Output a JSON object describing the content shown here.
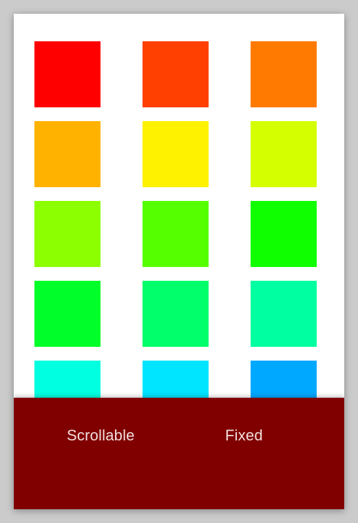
{
  "swatches": [
    {
      "name": "red",
      "color": "#ff0000"
    },
    {
      "name": "red-orange",
      "color": "#ff4000"
    },
    {
      "name": "orange",
      "color": "#ff7a00"
    },
    {
      "name": "amber",
      "color": "#ffb300"
    },
    {
      "name": "yellow",
      "color": "#fff200"
    },
    {
      "name": "yellow-green",
      "color": "#d4ff00"
    },
    {
      "name": "chartreuse",
      "color": "#8cff00"
    },
    {
      "name": "lime",
      "color": "#55ff00"
    },
    {
      "name": "green",
      "color": "#10ff00"
    },
    {
      "name": "bright-green",
      "color": "#00ff2a"
    },
    {
      "name": "spring-green",
      "color": "#00ff6a"
    },
    {
      "name": "aquamarine",
      "color": "#00ffa0"
    },
    {
      "name": "turquoise",
      "color": "#00ffe0"
    },
    {
      "name": "cyan",
      "color": "#00e5ff"
    },
    {
      "name": "azure",
      "color": "#00a8ff"
    }
  ],
  "tabs": {
    "scrollable_label": "Scrollable",
    "fixed_label": "Fixed"
  },
  "colors": {
    "tabbar_background": "#800000",
    "tab_text": "#f2dede"
  }
}
